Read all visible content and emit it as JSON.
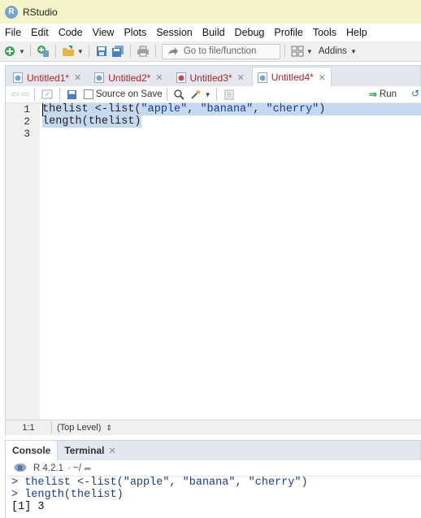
{
  "window": {
    "title": "RStudio",
    "logo_letter": "R"
  },
  "menu": [
    "File",
    "Edit",
    "Code",
    "View",
    "Plots",
    "Session",
    "Build",
    "Debug",
    "Profile",
    "Tools",
    "Help"
  ],
  "toolbar": {
    "goto_placeholder": "Go to file/function",
    "addins_label": "Addins"
  },
  "editor_tabs": [
    {
      "label": "Untitled1*",
      "active": false,
      "icon": "r-script-icon"
    },
    {
      "label": "Untitled2*",
      "active": false,
      "icon": "r-script-icon"
    },
    {
      "label": "Untitled3*",
      "active": false,
      "icon": "r-markdown-icon"
    },
    {
      "label": "Untitled4*",
      "active": true,
      "icon": "r-script-icon"
    }
  ],
  "editor_toolbar": {
    "source_on_save": "Source on Save",
    "run_label": "Run"
  },
  "editor": {
    "lines": [
      {
        "num": "1",
        "code": "thelist <-list(\"apple\", \"banana\", \"cherry\")"
      },
      {
        "num": "2",
        "code": "length(thelist)"
      },
      {
        "num": "3",
        "code": ""
      }
    ]
  },
  "status": {
    "position": "1:1",
    "scope": "(Top Level)"
  },
  "console_tabs": [
    {
      "label": "Console",
      "active": true
    },
    {
      "label": "Terminal",
      "active": false
    }
  ],
  "console": {
    "version": "R 4.2.1",
    "wd": "· ~/",
    "lines": [
      {
        "type": "cmd",
        "text": "> thelist <-list(\"apple\", \"banana\", \"cherry\")"
      },
      {
        "type": "cmd",
        "text": "> length(thelist)"
      },
      {
        "type": "out",
        "text": "[1] 3"
      }
    ]
  },
  "colors": {
    "title_bar": "#f3f4c9",
    "tab_text": "#b3212a",
    "selection": "#c5d9f1",
    "string": "#1a3c8f"
  }
}
